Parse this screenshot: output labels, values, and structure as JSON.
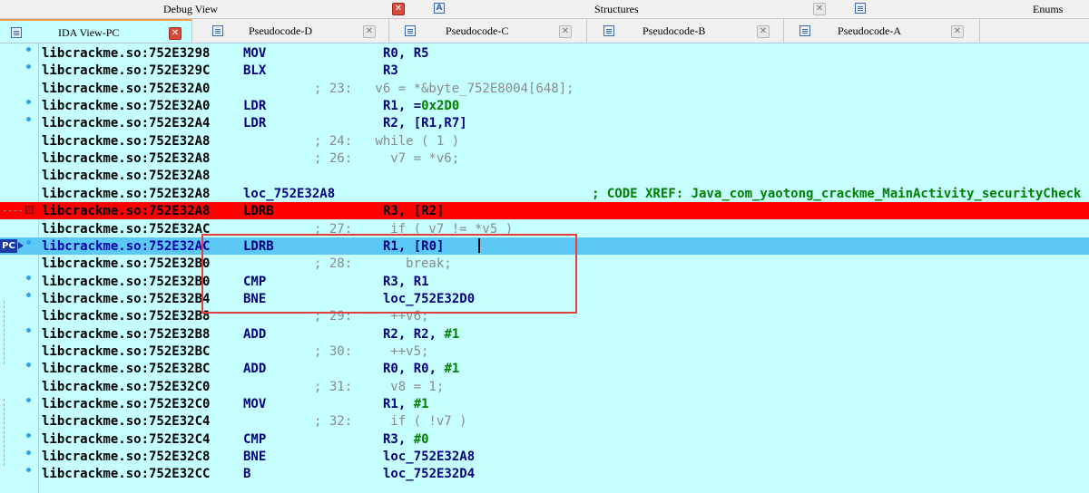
{
  "top_tabs": {
    "debug_view": "Debug View",
    "structures": "Structures",
    "enums": "Enums"
  },
  "tabs": [
    {
      "label": "IDA View-PC"
    },
    {
      "label": "Pseudocode-D"
    },
    {
      "label": "Pseudocode-C"
    },
    {
      "label": "Pseudocode-B"
    },
    {
      "label": "Pseudocode-A"
    }
  ],
  "pc_badge": "PC",
  "lines": [
    {
      "addr": "libcrackme.so:752E3298",
      "mnem": "MOV",
      "ops": "R0, R5"
    },
    {
      "addr": "libcrackme.so:752E329C",
      "mnem": "BLX",
      "ops": "R3"
    },
    {
      "addr": "libcrackme.so:752E32A0",
      "cmt": "; 23:   v6 = *&byte_752E8004[648];"
    },
    {
      "addr": "libcrackme.so:752E32A0",
      "mnem": "LDR",
      "ops": "R1, =0x2D0"
    },
    {
      "addr": "libcrackme.so:752E32A4",
      "mnem": "LDR",
      "ops": "R2, [R1,R7]"
    },
    {
      "addr": "libcrackme.so:752E32A8",
      "cmt": "; 24:   while ( 1 )"
    },
    {
      "addr": "libcrackme.so:752E32A8",
      "cmt": "; 26:     v7 = *v6;"
    },
    {
      "addr": "libcrackme.so:752E32A8"
    },
    {
      "addr": "libcrackme.so:752E32A8",
      "label": "loc_752E32A8",
      "xref": "; CODE XREF: Java_com_yaotong_crackme_MainActivity_securityCheck"
    },
    {
      "addr": "libcrackme.so:752E32A8",
      "mnem": "LDRB",
      "ops": "R3, [R2]"
    },
    {
      "addr": "libcrackme.so:752E32AC",
      "cmt": "; 27:     if ( v7 != *v5 )"
    },
    {
      "addr": "libcrackme.so:752E32AC",
      "mnem": "LDRB",
      "ops": "R1, [R0]"
    },
    {
      "addr": "libcrackme.so:752E32B0",
      "cmt": "; 28:       break;"
    },
    {
      "addr": "libcrackme.so:752E32B0",
      "mnem": "CMP",
      "ops": "R3, R1"
    },
    {
      "addr": "libcrackme.so:752E32B4",
      "mnem": "BNE",
      "ops": "loc_752E32D0"
    },
    {
      "addr": "libcrackme.so:752E32B8",
      "cmt": "; 29:     ++v6;"
    },
    {
      "addr": "libcrackme.so:752E32B8",
      "mnem": "ADD",
      "ops": "R2, R2, #1"
    },
    {
      "addr": "libcrackme.so:752E32BC",
      "cmt": "; 30:     ++v5;"
    },
    {
      "addr": "libcrackme.so:752E32BC",
      "mnem": "ADD",
      "ops": "R0, R0, #1"
    },
    {
      "addr": "libcrackme.so:752E32C0",
      "cmt": "; 31:     v8 = 1;"
    },
    {
      "addr": "libcrackme.so:752E32C0",
      "mnem": "MOV",
      "ops": "R1, #1"
    },
    {
      "addr": "libcrackme.so:752E32C4",
      "cmt": "; 32:     if ( !v7 )"
    },
    {
      "addr": "libcrackme.so:752E32C4",
      "mnem": "CMP",
      "ops": "R3, #0"
    },
    {
      "addr": "libcrackme.so:752E32C8",
      "mnem": "BNE",
      "ops": "loc_752E32A8"
    },
    {
      "addr": "libcrackme.so:752E32CC",
      "mnem": "B",
      "ops": "loc_752E32D4"
    }
  ],
  "colors": {
    "background": "#c6ffff",
    "breakpoint": "#ff0000",
    "pc_highlight": "#5cc8f5",
    "instruction": "#000080",
    "comment": "#8a8a8a",
    "xref": "#008000"
  }
}
